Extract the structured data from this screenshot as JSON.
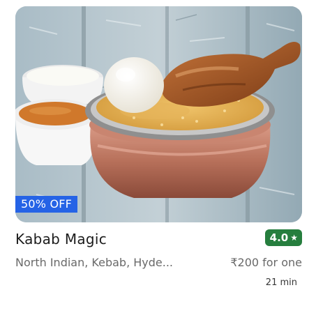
{
  "restaurant": {
    "name": "Kabab Magic",
    "rating": "4.0",
    "rating_icon": "star-icon",
    "cuisines": "North Indian, Kebab, Hyde...",
    "price_for_one": "₹200 for one",
    "delivery_time": "21 min",
    "offer": "50% OFF",
    "image_icon": "biryani-dish-photo"
  },
  "colors": {
    "offer_badge": "#2563e6",
    "rating_badge": "#267e3e",
    "name_text": "#1c1c1c",
    "secondary_text": "#696969",
    "time_text": "#363636"
  }
}
